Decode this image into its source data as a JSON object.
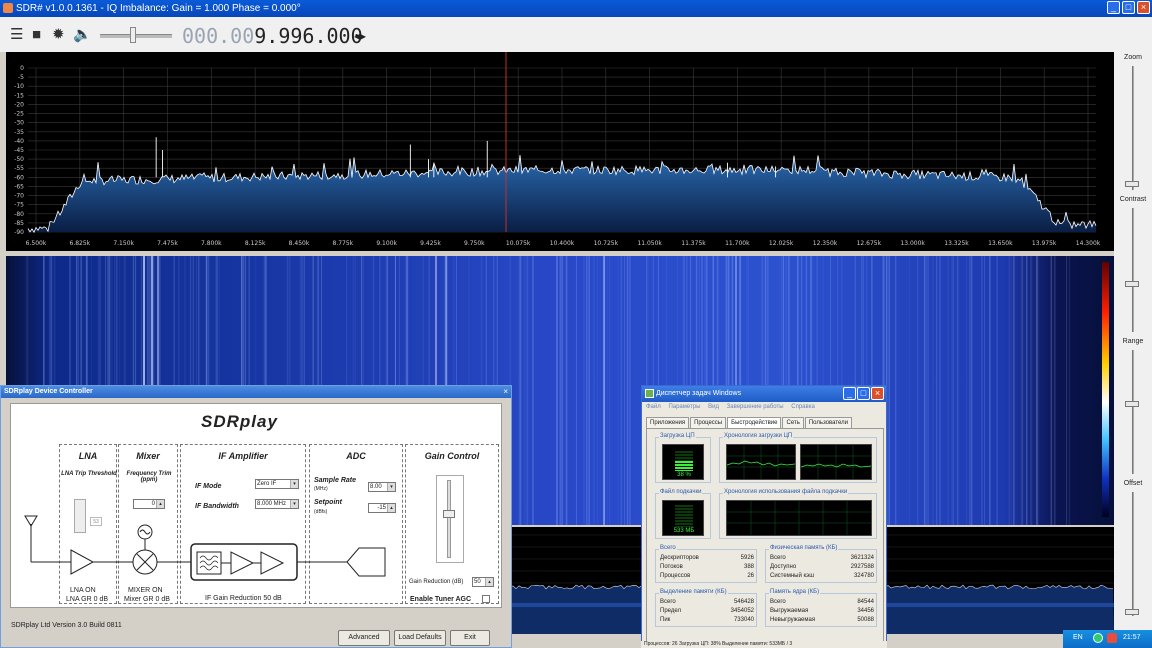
{
  "window": {
    "title": "SDR# v1.0.0.1361 - IQ Imbalance: Gain = 1.000 Phase = 0.000°"
  },
  "toolbar": {
    "frequency_dim": "000.00",
    "frequency_main": "9.996.000",
    "freq_arrows": "◂▸"
  },
  "spectrum": {
    "y_ticks": [
      "0",
      "-5",
      "-10",
      "-15",
      "-20",
      "-25",
      "-30",
      "-35",
      "-40",
      "-45",
      "-50",
      "-55",
      "-60",
      "-65",
      "-70",
      "-75",
      "-80",
      "-85",
      "-90"
    ],
    "x_ticks": [
      "6.500k",
      "6.825k",
      "7.150k",
      "7.475k",
      "7.800k",
      "8.125k",
      "8.450k",
      "8.775k",
      "9.100k",
      "9.425k",
      "9.750k",
      "10.075k",
      "10.400k",
      "10.725k",
      "11.050k",
      "11.375k",
      "11.700k",
      "12.025k",
      "12.350k",
      "12.675k",
      "13.000k",
      "13.325k",
      "13.650k",
      "13.975k",
      "14.300k"
    ]
  },
  "right_panel": {
    "zoom": "Zoom",
    "contrast": "Contrast",
    "range": "Range",
    "offset": "Offset"
  },
  "dialog": {
    "title": "SDRplay Device Controller",
    "logo": "SDRplay",
    "lna": {
      "title": "LNA",
      "trip": "LNA Trip Threshold",
      "value": "53",
      "status": "LNA ON",
      "gr": "LNA GR 0 dB"
    },
    "mixer": {
      "title": "Mixer",
      "trim": "Frequency Trim (ppm)",
      "trim_value": "0",
      "status": "MIXER ON",
      "gr": "Mixer GR 0 dB"
    },
    "if": {
      "title": "IF Amplifier",
      "mode_label": "IF Mode",
      "mode_value": "Zero IF",
      "bw_label": "IF Bandwidth",
      "bw_value": "8.000 MHz",
      "gr": "IF Gain Reduction 50 dB"
    },
    "adc": {
      "title": "ADC",
      "rate_label": "Sample Rate",
      "rate_unit": "(MHz)",
      "rate_value": "8.00",
      "setpoint_label": "Setpoint",
      "setpoint_unit": "(dBfs)",
      "setpoint_value": "-15"
    },
    "gain": {
      "title": "Gain Control",
      "reduction_label": "Gain Reduction (dB)",
      "reduction_value": "50",
      "agc_label": "Enable Tuner AGC"
    },
    "footer": "SDRplay Ltd   Version 3.0   Build 0811",
    "buttons": {
      "advanced": "Advanced",
      "load_defaults": "Load Defaults",
      "exit": "Exit"
    }
  },
  "taskmgr": {
    "title": "Диспетчер задач Windows",
    "menu": [
      "Файл",
      "Параметры",
      "Вид",
      "Завершение работы",
      "Справка"
    ],
    "tabs": [
      "Приложения",
      "Процессы",
      "Быстродействие",
      "Сеть",
      "Пользователи"
    ],
    "active_tab": "Быстродействие",
    "cpu_label": "Загрузка ЦП",
    "cpu_value": "38 %",
    "cpu_history_label": "Хронология загрузки ЦП",
    "page_label": "Файл подкачки",
    "page_value": "533 МБ",
    "page_history_label": "Хронология использования файла подкачки",
    "totals": {
      "label": "Всего",
      "rows": [
        [
          "Дескрипторов",
          "5926"
        ],
        [
          "Потоков",
          "388"
        ],
        [
          "Процессов",
          "26"
        ]
      ]
    },
    "phys": {
      "label": "Физическая память (КБ)",
      "rows": [
        [
          "Всего",
          "3621324"
        ],
        [
          "Доступно",
          "2927588"
        ],
        [
          "Системный кэш",
          "324780"
        ]
      ]
    },
    "commit": {
      "label": "Выделение памяти (КБ)",
      "rows": [
        [
          "Всего",
          "546428"
        ],
        [
          "Предел",
          "3454052"
        ],
        [
          "Пик",
          "733040"
        ]
      ]
    },
    "kernel": {
      "label": "Память ядра (КБ)",
      "rows": [
        [
          "Всего",
          "84544"
        ],
        [
          "Выгружаемая",
          "34456"
        ],
        [
          "Невыгружаемая",
          "50088"
        ]
      ]
    },
    "status": "Процессов: 26     Загрузка ЦП: 38%     Выделение памяти: 533МБ / 3"
  },
  "taskbar": {
    "lang": "EN",
    "time": "21:57"
  },
  "colors": {
    "spectrum_fill": "#1a4a8c",
    "spectrum_line": "#ffffff",
    "waterfall_bg": "#0b1960",
    "center_line": "#c0302a"
  }
}
